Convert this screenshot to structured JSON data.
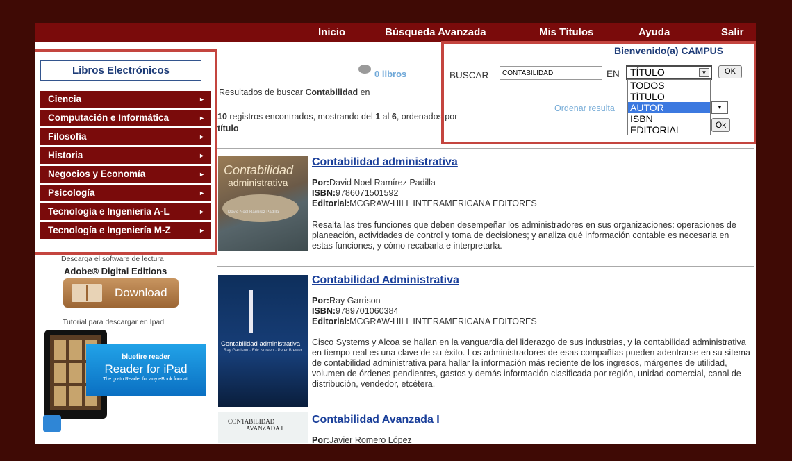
{
  "nav": {
    "inicio": "Inicio",
    "busqueda": "Búsqueda Avanzada",
    "mis_titulos": "Mis Títulos",
    "ayuda": "Ayuda",
    "salir": "Salir"
  },
  "welcome": "Bienvenido(a) CAMPUS",
  "sidebar": {
    "title": "Libros Electrónicos",
    "categories": [
      {
        "label": "Ciencia"
      },
      {
        "label": "Computación e Informática"
      },
      {
        "label": "Filosofía"
      },
      {
        "label": "Historia"
      },
      {
        "label": "Negocios y Economía"
      },
      {
        "label": "Psicología"
      },
      {
        "label": "Tecnología e Ingeniería A-L"
      },
      {
        "label": "Tecnología e Ingeniería M-Z"
      }
    ],
    "arrow_glyph": "►",
    "download_text": "Descarga el software de lectura",
    "adobe_label": "Adobe® Digital Editions",
    "download_button": "Download",
    "tutorial_text": "Tutorial para descargar en Ipad",
    "banner": {
      "line1": "bluefire reader",
      "line2": "Reader for iPad",
      "line3": "The go-to Reader for any eBook format."
    }
  },
  "results_header": {
    "books_count": "0 libros",
    "results_for_prefix": "Resultados de buscar ",
    "results_for_term": "Contabilidad",
    "results_for_suffix": " en",
    "records_count": "10",
    "records_text1": " registros encontrados, mostrando del ",
    "records_from": "1",
    "records_text2": " al ",
    "records_to": "6",
    "records_text3": ", ordenados por",
    "records_order": "título"
  },
  "search": {
    "buscar_label": "BUSCAR",
    "value": "CONTABILIDAD",
    "en_label": "EN",
    "field_selected": "TÍTULO",
    "dropdown_glyph": "▼",
    "ok": "OK",
    "options": [
      "TODOS",
      "TÍTULO",
      "AUTOR",
      "ISBN",
      "EDITORIAL"
    ],
    "highlighted_option": "AUTOR",
    "sort_label": "Ordenar resulta",
    "sort_ok": "Ok"
  },
  "results": [
    {
      "title": "Contabilidad administrativa",
      "por_label": "Por:",
      "author": "David Noel Ramírez Padilla",
      "isbn_label": "ISBN:",
      "isbn": "9786071501592",
      "editorial_label": "Editorial:",
      "editorial": "MCGRAW-HILL INTERAMERICANA EDITORES",
      "description": "Resalta las tres funciones que deben desempeñar los administradores en sus organizaciones: operaciones de planeación, actividades de control y toma de decisiones; y analiza qué información contable es necesaria en estas funciones, y cómo recabarla e interpretarla.",
      "cover_title": "Contabilidad",
      "cover_sub": "administrativa",
      "cover_author": "David Noel Ramírez Padilla"
    },
    {
      "title": "Contabilidad Administrativa",
      "por_label": "Por:",
      "author": "Ray Garrison",
      "isbn_label": "ISBN:",
      "isbn": "9789701060384",
      "editorial_label": "Editorial:",
      "editorial": "MCGRAW-HILL INTERAMERICANA EDITORES",
      "description": "Cisco Systems y Alcoa se hallan en la vanguardia del liderazgo de sus industrias, y la contabilidad administrativa en tiempo real es una clave de su éxito. Los administradores de esas compañías pueden adentrarse en su sitema de contabilidad administrativa para hallar la información más reciente de los ingresos, márgenes de utilidad, volumen de órdenes pendientes, gastos y demás información clasificada por región, unidad comercial, canal de distribución, vendedor, etcétera.",
      "cover_title": "Contabilidad administrativa",
      "cover_author": "Ray Garrison · Eric Noreen · Peter Brewer"
    },
    {
      "title": "Contabilidad Avanzada I",
      "por_label": "Por:",
      "author": "Javier Romero López",
      "cover_title": "CONTABILIDAD",
      "cover_sub": "AVANZADA I"
    }
  ],
  "colors": {
    "nav_bg": "#7a0b0b",
    "outer_bg": "#3f0a05",
    "link": "#1a3f9a",
    "highlight_box": "#c4453f",
    "selected_option": "#3c79e0"
  }
}
